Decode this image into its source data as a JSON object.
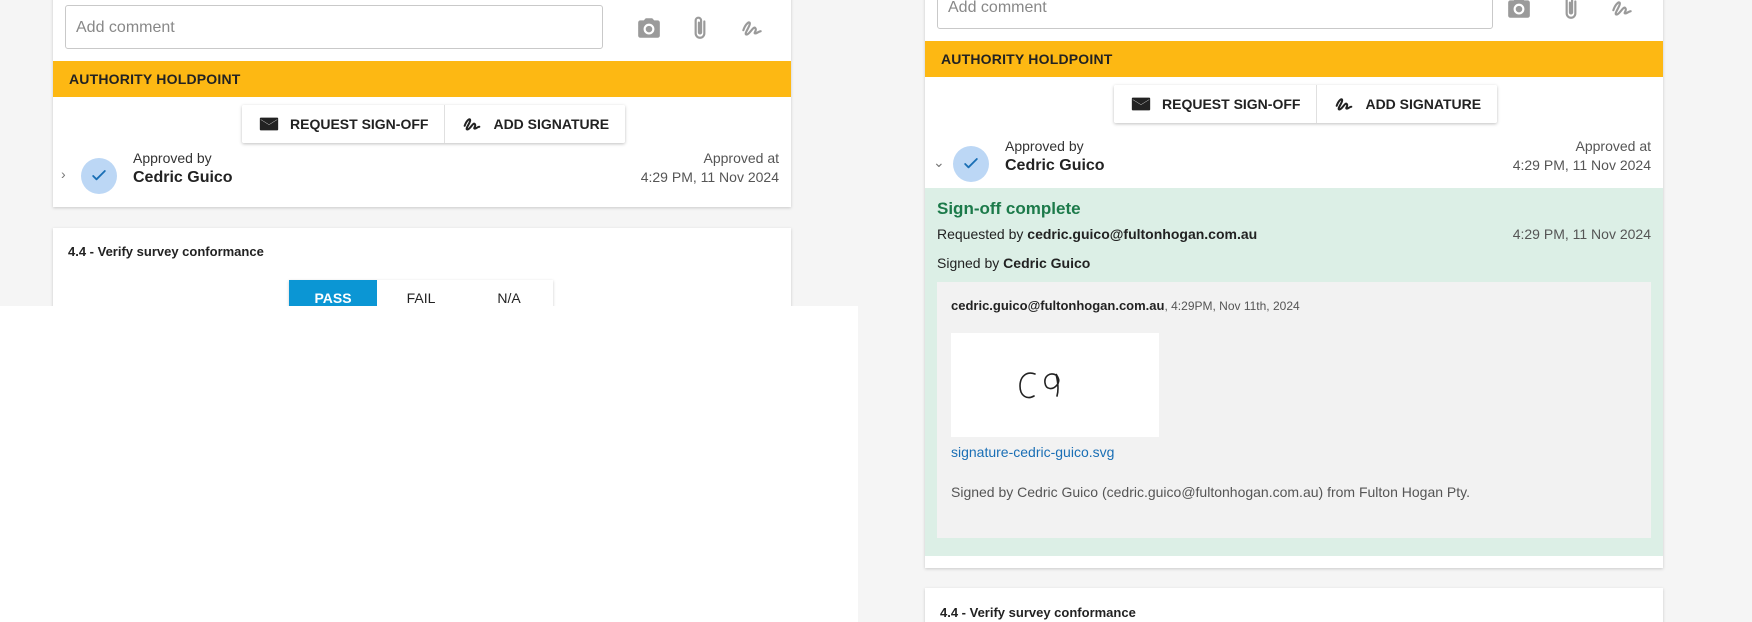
{
  "left": {
    "comment_placeholder": "Add comment",
    "holdpoint_label": "AUTHORITY HOLDPOINT",
    "buttons": {
      "request_signoff": "REQUEST SIGN-OFF",
      "add_signature": "ADD SIGNATURE"
    },
    "approval": {
      "label": "Approved by",
      "name": "Cedric Guico",
      "at_label": "Approved at",
      "at_value": "4:29 PM, 11 Nov 2024"
    },
    "next_section": {
      "title": "4.4 - Verify survey conformance",
      "options": [
        "PASS",
        "FAIL",
        "N/A"
      ],
      "selected": "PASS"
    }
  },
  "right": {
    "comment_placeholder": "Add comment",
    "holdpoint_label": "AUTHORITY HOLDPOINT",
    "buttons": {
      "request_signoff": "REQUEST SIGN-OFF",
      "add_signature": "ADD SIGNATURE"
    },
    "approval": {
      "label": "Approved by",
      "name": "Cedric Guico",
      "at_label": "Approved at",
      "at_value": "4:29 PM, 11 Nov 2024"
    },
    "signoff": {
      "title": "Sign-off complete",
      "requested_prefix": "Requested by",
      "requested_by": "cedric.guico@fultonhogan.com.au",
      "requested_at": "4:29 PM, 11 Nov 2024",
      "signed_prefix": "Signed by",
      "signed_by": "Cedric Guico",
      "signer_email": "cedric.guico@fultonhogan.com.au",
      "signer_time": ", 4:29PM, Nov 11th, 2024",
      "signature_glyph": "CG",
      "signature_file": "signature-cedric-guico.svg",
      "statement": "Signed by Cedric Guico (cedric.guico@fultonhogan.com.au) from Fulton Hogan Pty."
    },
    "next_section": {
      "title": "4.4 - Verify survey conformance"
    }
  },
  "colors": {
    "holdpoint": "#fdb813",
    "accent": "#0b96d4",
    "success_bg": "#dcefe6",
    "success_text": "#1c7a4a",
    "link": "#1a6fb5",
    "check_circle": "#bcd7f5"
  },
  "icons": [
    "camera-icon",
    "paperclip-icon",
    "signature-icon",
    "envelope-icon",
    "check-icon",
    "chevron-right-icon",
    "chevron-down-icon"
  ]
}
